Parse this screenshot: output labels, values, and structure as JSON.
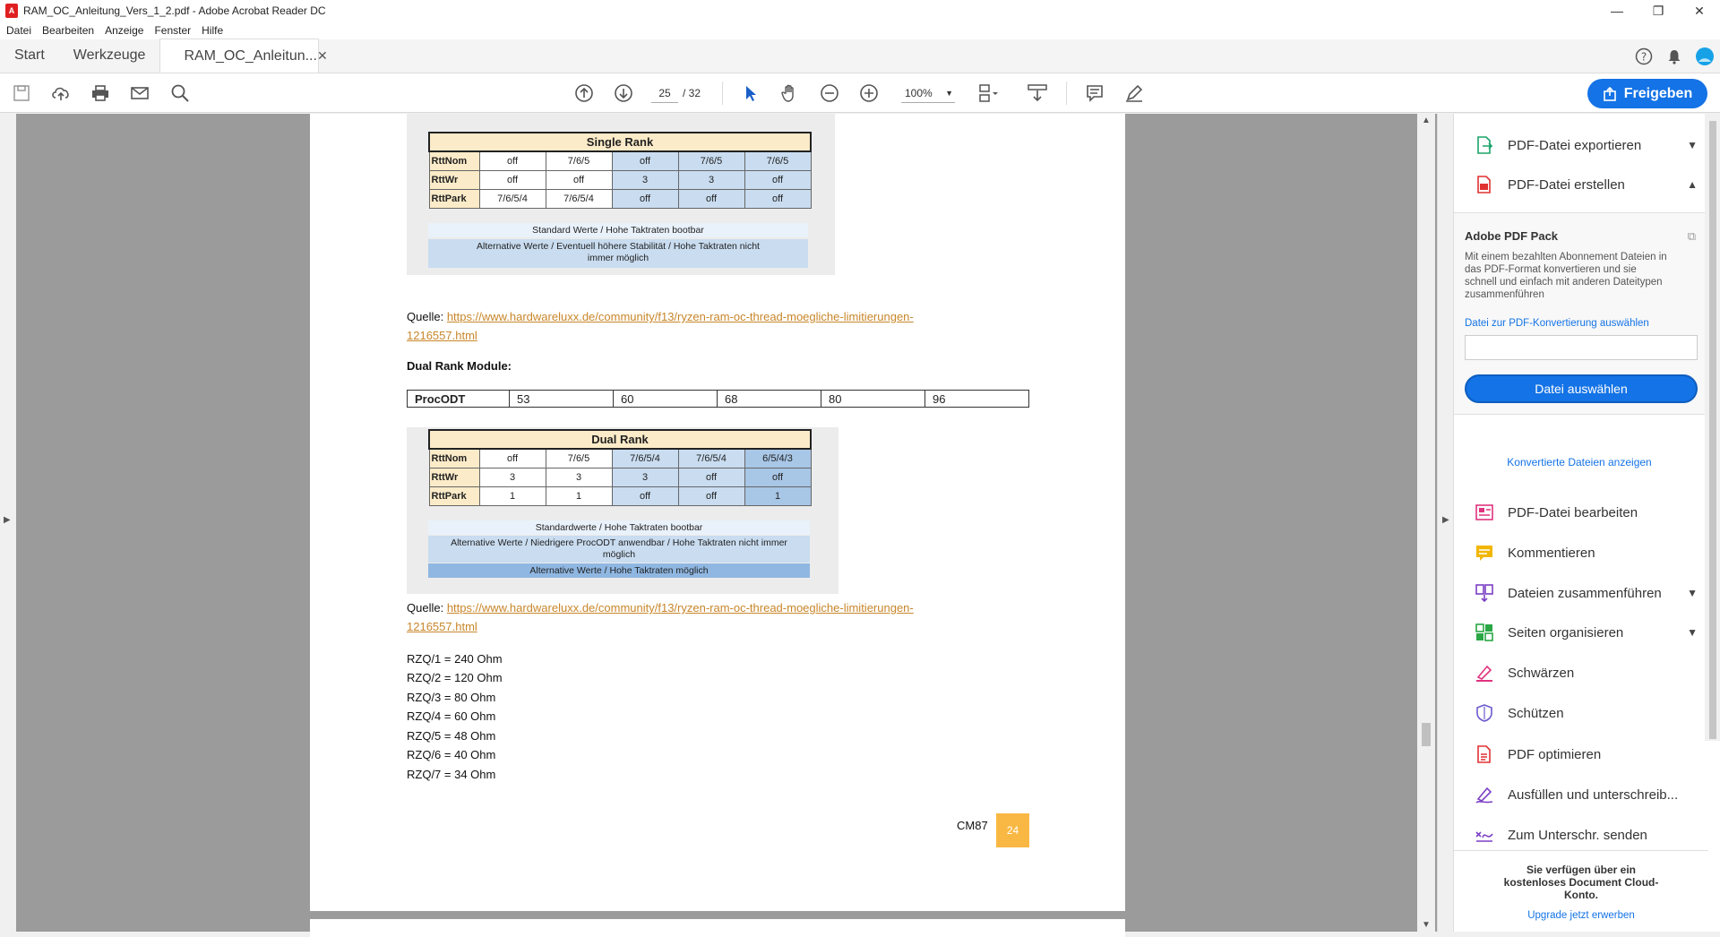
{
  "window": {
    "title": "RAM_OC_Anleitung_Vers_1_2.pdf - Adobe Acrobat Reader DC",
    "controls": [
      "—",
      "❐",
      "✕"
    ]
  },
  "menu": [
    "Datei",
    "Bearbeiten",
    "Anzeige",
    "Fenster",
    "Hilfe"
  ],
  "tabs": {
    "start": "Start",
    "tools": "Werkzeuge",
    "doc": "RAM_OC_Anleitun...",
    "close": "✕"
  },
  "toolbar": {
    "page_current": "25",
    "page_total": "/ 32",
    "zoom": "100%",
    "share_label": "Freigeben"
  },
  "page": {
    "single_rank": {
      "title": "Single Rank",
      "rows": [
        {
          "label": "RttNom",
          "cells": [
            "off",
            "7/6/5",
            "off",
            "7/6/5",
            "7/6/5"
          ]
        },
        {
          "label": "RttWr",
          "cells": [
            "off",
            "off",
            "3",
            "3",
            "off"
          ]
        },
        {
          "label": "RttPark",
          "cells": [
            "7/6/5/4",
            "7/6/5/4",
            "off",
            "off",
            "off"
          ]
        }
      ],
      "legend1": "Standard Werte / Hohe Taktraten bootbar",
      "legend2": "Alternative Werte / Eventuell höhere Stabilität / Hohe Taktraten nicht immer möglich"
    },
    "source1_label": "Quelle: ",
    "source1_link_a": "https://www.hardwareluxx.de/community/f13/ryzen-ram-oc-thread-moegliche-limitierungen-",
    "source1_link_b": "1216557.html",
    "dual_heading": "Dual Rank Module:",
    "procodt": {
      "label": "ProcODT",
      "values": [
        "53",
        "60",
        "68",
        "80",
        "96"
      ]
    },
    "dual_rank": {
      "title": "Dual Rank",
      "rows": [
        {
          "label": "RttNom",
          "cells": [
            "off",
            "7/6/5",
            "7/6/5/4",
            "7/6/5/4",
            "6/5/4/3"
          ]
        },
        {
          "label": "RttWr",
          "cells": [
            "3",
            "3",
            "3",
            "off",
            "off"
          ]
        },
        {
          "label": "RttPark",
          "cells": [
            "1",
            "1",
            "off",
            "off",
            "1"
          ]
        }
      ],
      "legend1": "Standardwerte / Hohe Taktraten bootbar",
      "legend2": "Alternative Werte / Niedrigere ProcODT anwendbar / Hohe Taktraten nicht immer möglich",
      "legend3": "Alternative Werte / Hohe Taktraten möglich"
    },
    "source2_label": "Quelle: ",
    "source2_link_a": "https://www.hardwareluxx.de/community/f13/ryzen-ram-oc-thread-moegliche-limitierungen-",
    "source2_link_b": "1216557.html",
    "rzq": [
      "RZQ/1 = 240 Ohm",
      "RZQ/2 = 120 Ohm",
      "RZQ/3 = 80 Ohm",
      "RZQ/4 = 60 Ohm",
      "RZQ/5 = 48 Ohm",
      "RZQ/6 = 40 Ohm",
      "RZQ/7 = 34 Ohm"
    ],
    "footer_label": "CM87",
    "footer_page": "24"
  },
  "right_panel": {
    "export": "PDF-Datei exportieren",
    "create": "PDF-Datei erstellen",
    "pack_title": "Adobe PDF Pack",
    "pack_desc": "Mit einem bezahlten Abonnement Dateien in das PDF-Format konvertieren und sie schnell und einfach mit anderen Dateitypen zusammenführen",
    "select_label": "Datei zur PDF-Konvertierung auswählen",
    "select_button": "Datei auswählen",
    "converted_link": "Konvertierte Dateien anzeigen",
    "tools": [
      "PDF-Datei bearbeiten",
      "Kommentieren",
      "Dateien zusammenführen",
      "Seiten organisieren",
      "Schwärzen",
      "Schützen",
      "PDF optimieren",
      "Ausfüllen und unterschreib...",
      "Zum Unterschr. senden"
    ],
    "footer_text": "Sie verfügen über ein kostenloses Document Cloud-Konto.",
    "footer_link": "Upgrade jetzt erwerben"
  },
  "colors": {
    "accent": "#1473e6",
    "page_badge": "#f9b843",
    "link": "#c8862a"
  }
}
